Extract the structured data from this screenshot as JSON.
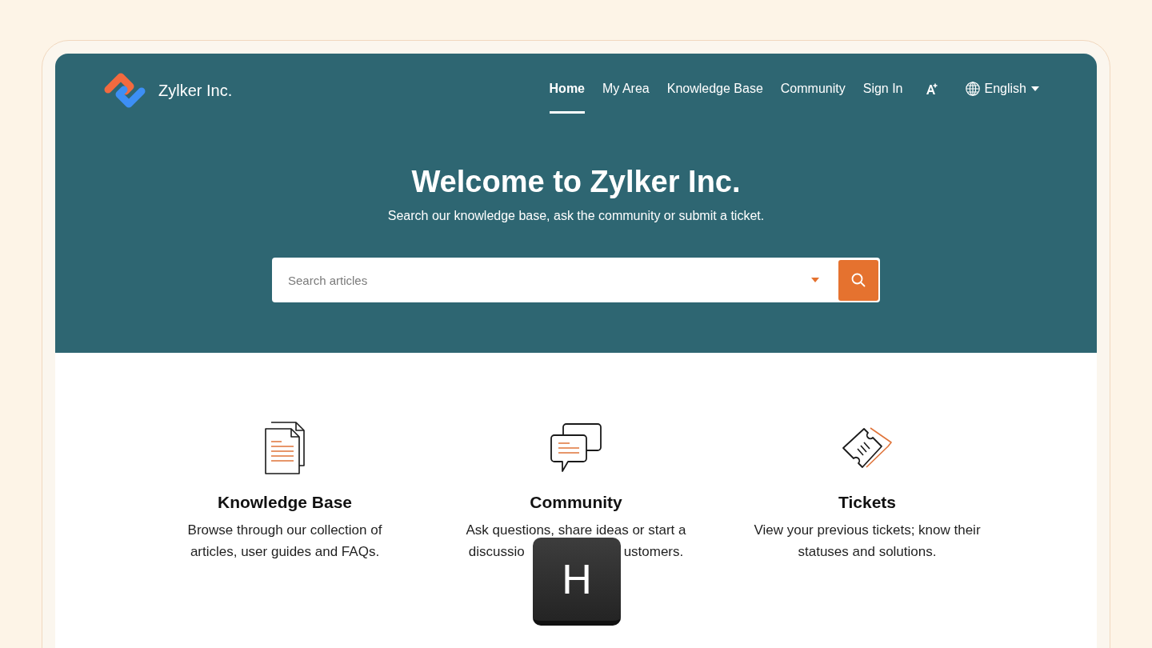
{
  "brand": {
    "name": "Zylker Inc."
  },
  "nav": {
    "items": [
      {
        "label": "Home",
        "selected": true
      },
      {
        "label": "My Area",
        "selected": false
      },
      {
        "label": "Knowledge Base",
        "selected": false
      },
      {
        "label": "Community",
        "selected": false
      },
      {
        "label": "Sign In",
        "selected": false
      }
    ],
    "language": {
      "label": "English"
    }
  },
  "hero": {
    "title": "Welcome to Zylker Inc.",
    "subtitle": "Search our knowledge base, ask the community or submit a ticket.",
    "search": {
      "placeholder": "Search articles"
    }
  },
  "cards": [
    {
      "kind": "documents",
      "title": "Knowledge Base",
      "description_lines": [
        [
          "Browse through our collection of"
        ],
        [
          "articles, user guides and FAQs."
        ]
      ]
    },
    {
      "kind": "chat",
      "title": "Community",
      "description_lines": [
        [
          "Ask questions, share ideas or start a"
        ],
        [
          "discussio",
          "ustomers."
        ]
      ]
    },
    {
      "kind": "ticket",
      "title": "Tickets",
      "description_lines": [
        [
          "View your previous tickets; know their"
        ],
        [
          "statuses and solutions."
        ]
      ]
    }
  ],
  "key_overlay": {
    "label": "H"
  }
}
